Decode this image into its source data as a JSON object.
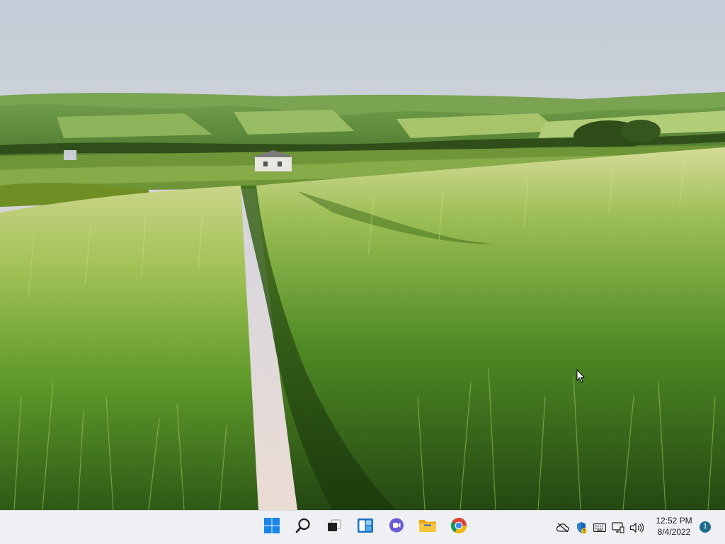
{
  "desktop": {
    "wallpaper": "green-wheat-field-with-path-and-rolling-hills"
  },
  "taskbar": {
    "pinned": [
      {
        "name": "start-button",
        "icon": "windows-logo-icon"
      },
      {
        "name": "search-button",
        "icon": "search-icon"
      },
      {
        "name": "task-view-button",
        "icon": "task-view-icon"
      },
      {
        "name": "widgets-button",
        "icon": "widgets-icon"
      },
      {
        "name": "chat-button",
        "icon": "teams-chat-icon"
      },
      {
        "name": "file-explorer-button",
        "icon": "folder-icon"
      },
      {
        "name": "chrome-button",
        "icon": "chrome-icon"
      }
    ],
    "tray": {
      "icons": [
        "onedrive-offline-icon",
        "security-warning-icon",
        "keyboard-icon",
        "network-icon",
        "volume-icon"
      ],
      "time": "12:52 PM",
      "date": "8/4/2022",
      "notification_count": "1"
    }
  },
  "colors": {
    "accent": "#0078d4",
    "taskbar_bg": "#eef0f3",
    "badge": "#1e6d8f"
  }
}
